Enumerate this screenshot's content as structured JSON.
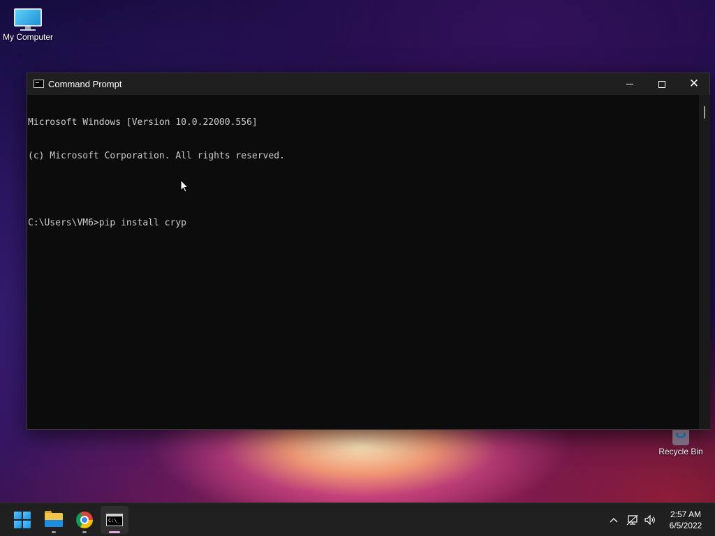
{
  "desktop": {
    "icons": [
      {
        "label": "My Computer",
        "icon": "monitor-icon"
      },
      {
        "label": "Recycle Bin",
        "icon": "recycle-bin-icon"
      }
    ]
  },
  "window": {
    "title": "Command Prompt",
    "icon": "command-prompt-icon",
    "controls": {
      "minimize": "minimize-icon",
      "maximize": "maximize-icon",
      "close": "close-icon"
    },
    "console": {
      "lines": [
        "Microsoft Windows [Version 10.0.22000.556]",
        "(c) Microsoft Corporation. All rights reserved.",
        "",
        "C:\\Users\\VM6>pip install cryp"
      ]
    }
  },
  "taskbar": {
    "apps": [
      {
        "name": "Start",
        "icon": "windows-logo-icon"
      },
      {
        "name": "File Explorer",
        "icon": "folder-icon"
      },
      {
        "name": "Google Chrome",
        "icon": "chrome-icon"
      },
      {
        "name": "Command Prompt",
        "icon": "command-prompt-icon",
        "active": true
      }
    ],
    "tray": {
      "chevron": "^",
      "icons": [
        "chevron-up-icon",
        "network-icon",
        "volume-icon"
      ]
    },
    "clock": {
      "time": "2:57 AM",
      "date": "6/5/2022"
    }
  },
  "colors": {
    "console_bg": "#0c0c0c",
    "console_text": "#cccccc",
    "titlebar": "#1f1f1f",
    "taskbar": "#202020",
    "active_indicator": "#e8a6d8"
  }
}
